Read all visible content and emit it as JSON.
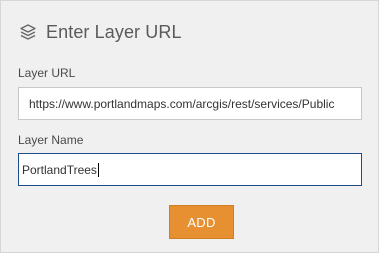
{
  "header": {
    "title": "Enter Layer URL",
    "icon": "layers-icon"
  },
  "form": {
    "url_label": "Layer URL",
    "url_value": "https://www.portlandmaps.com/arcgis/rest/services/Public",
    "name_label": "Layer Name",
    "name_value": "PortlandTrees"
  },
  "actions": {
    "add_label": "ADD"
  },
  "colors": {
    "accent": "#e69032",
    "focus_border": "#1c4f88",
    "panel_bg": "#f0f0f0"
  }
}
